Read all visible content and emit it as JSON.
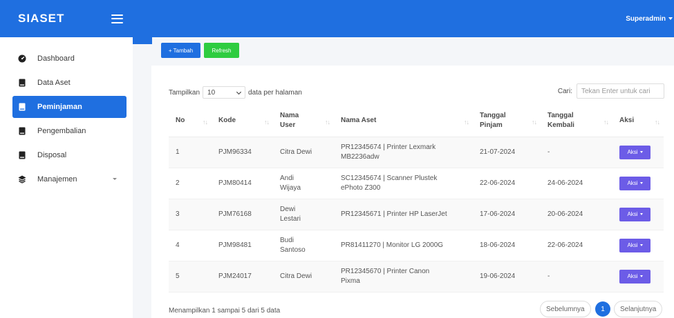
{
  "app": {
    "brand": "SIASET",
    "user": "Superadmin"
  },
  "sidebar": {
    "items": [
      {
        "label": "Dashboard"
      },
      {
        "label": "Data Aset"
      },
      {
        "label": "Peminjaman"
      },
      {
        "label": "Pengembalian"
      },
      {
        "label": "Disposal"
      },
      {
        "label": "Manajemen"
      }
    ]
  },
  "toolbar": {
    "add_label": "+ Tambah",
    "refresh_label": "Refresh"
  },
  "table_controls": {
    "show_label": "Tampilkan",
    "page_size": "10",
    "per_page_label": "data per halaman",
    "search_label": "Cari:",
    "search_placeholder": "Tekan Enter untuk cari"
  },
  "table": {
    "headers": {
      "no": "No",
      "kode": "Kode",
      "nama_user_1": "Nama",
      "nama_user_2": "User",
      "nama_aset": "Nama Aset",
      "tgl_pinjam_1": "Tanggal",
      "tgl_pinjam_2": "Pinjam",
      "tgl_kembali_1": "Tanggal",
      "tgl_kembali_2": "Kembali",
      "aksi": "Aksi"
    },
    "sort_glyph": "↑↓",
    "action_label": "Aksi",
    "rows": [
      {
        "no": "1",
        "kode": "PJM96334",
        "user_1": "Citra Dewi",
        "user_2": "",
        "aset_1": "PR12345674 | Printer Lexmark",
        "aset_2": "MB2236adw",
        "pinjam": "21-07-2024",
        "kembali": "-"
      },
      {
        "no": "2",
        "kode": "PJM80414",
        "user_1": "Andi",
        "user_2": "Wijaya",
        "aset_1": "SC12345674 | Scanner Plustek",
        "aset_2": "ePhoto Z300",
        "pinjam": "22-06-2024",
        "kembali": "24-06-2024"
      },
      {
        "no": "3",
        "kode": "PJM76168",
        "user_1": "Dewi",
        "user_2": "Lestari",
        "aset_1": "PR12345671 | Printer HP LaserJet",
        "aset_2": "",
        "pinjam": "17-06-2024",
        "kembali": "20-06-2024"
      },
      {
        "no": "4",
        "kode": "PJM98481",
        "user_1": "Budi",
        "user_2": "Santoso",
        "aset_1": "PR81411270 | Monitor LG 2000G",
        "aset_2": "",
        "pinjam": "18-06-2024",
        "kembali": "22-06-2024"
      },
      {
        "no": "5",
        "kode": "PJM24017",
        "user_1": "Citra Dewi",
        "user_2": "",
        "aset_1": "PR12345670 | Printer Canon",
        "aset_2": "Pixma",
        "pinjam": "19-06-2024",
        "kembali": "-"
      }
    ]
  },
  "footer": {
    "info": "Menampilkan 1 sampai 5 dari 5 data",
    "prev_label": "Sebelumnya",
    "current_page": "1",
    "next_label": "Selanjutnya"
  },
  "colors": {
    "primary": "#1f6fe0",
    "success": "#2ecc40",
    "action": "#6c5ce7"
  }
}
